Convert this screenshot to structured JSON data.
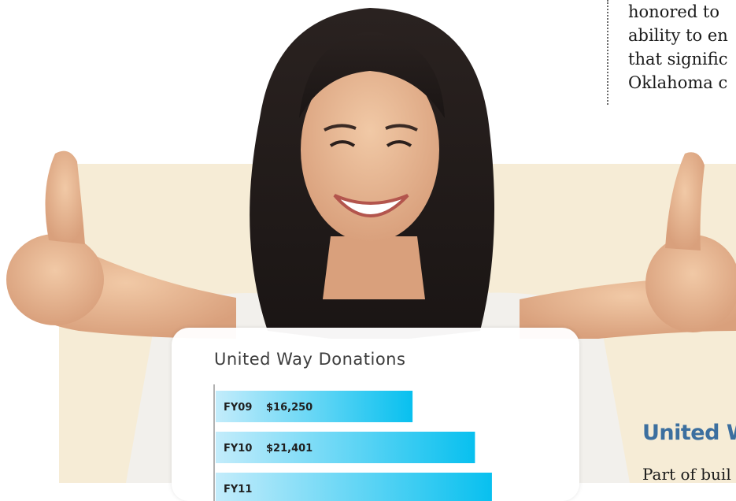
{
  "article": {
    "lines": [
      "honored to",
      "ability to en",
      "that signific",
      "Oklahoma c"
    ]
  },
  "section": {
    "heading": "United W",
    "text": "Part of buil"
  },
  "chart_data": {
    "type": "bar",
    "orientation": "horizontal",
    "title": "United Way Donations",
    "categories": [
      "FY09",
      "FY10",
      "FY11"
    ],
    "value_labels": [
      "$16,250",
      "$21,401",
      ""
    ],
    "values": [
      16250,
      21401,
      22800
    ],
    "xlim": [
      0,
      23000
    ],
    "colors": {
      "bar_start": "#c3ecfb",
      "bar_end": "#08c0ef",
      "label": "#1f1f1f",
      "axis": "#999999"
    }
  }
}
